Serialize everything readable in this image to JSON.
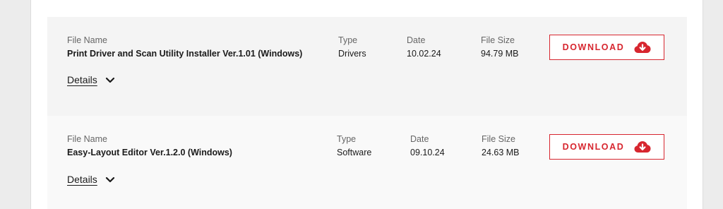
{
  "colors": {
    "accent": "#d7262f",
    "row_bg_1": "#f4f4f4",
    "row_bg_2": "#f9f9f9"
  },
  "files": [
    {
      "file_name_label": "File Name",
      "file_name": "Print Driver and Scan Utility Installer Ver.1.01 (Windows)",
      "type_label": "Type",
      "type": "Drivers",
      "date_label": "Date",
      "date": "10.02.24",
      "size_label": "File Size",
      "size": "94.79 MB",
      "download_label": "DOWNLOAD",
      "download_icon": "cloud-download-icon",
      "details_label": "Details",
      "details_icon": "chevron-down-icon"
    },
    {
      "file_name_label": "File Name",
      "file_name": "Easy-Layout Editor Ver.1.2.0 (Windows)",
      "type_label": "Type",
      "type": "Software",
      "date_label": "Date",
      "date": "09.10.24",
      "size_label": "File Size",
      "size": "24.63 MB",
      "download_label": "DOWNLOAD",
      "download_icon": "cloud-download-icon",
      "details_label": "Details",
      "details_icon": "chevron-down-icon"
    }
  ]
}
